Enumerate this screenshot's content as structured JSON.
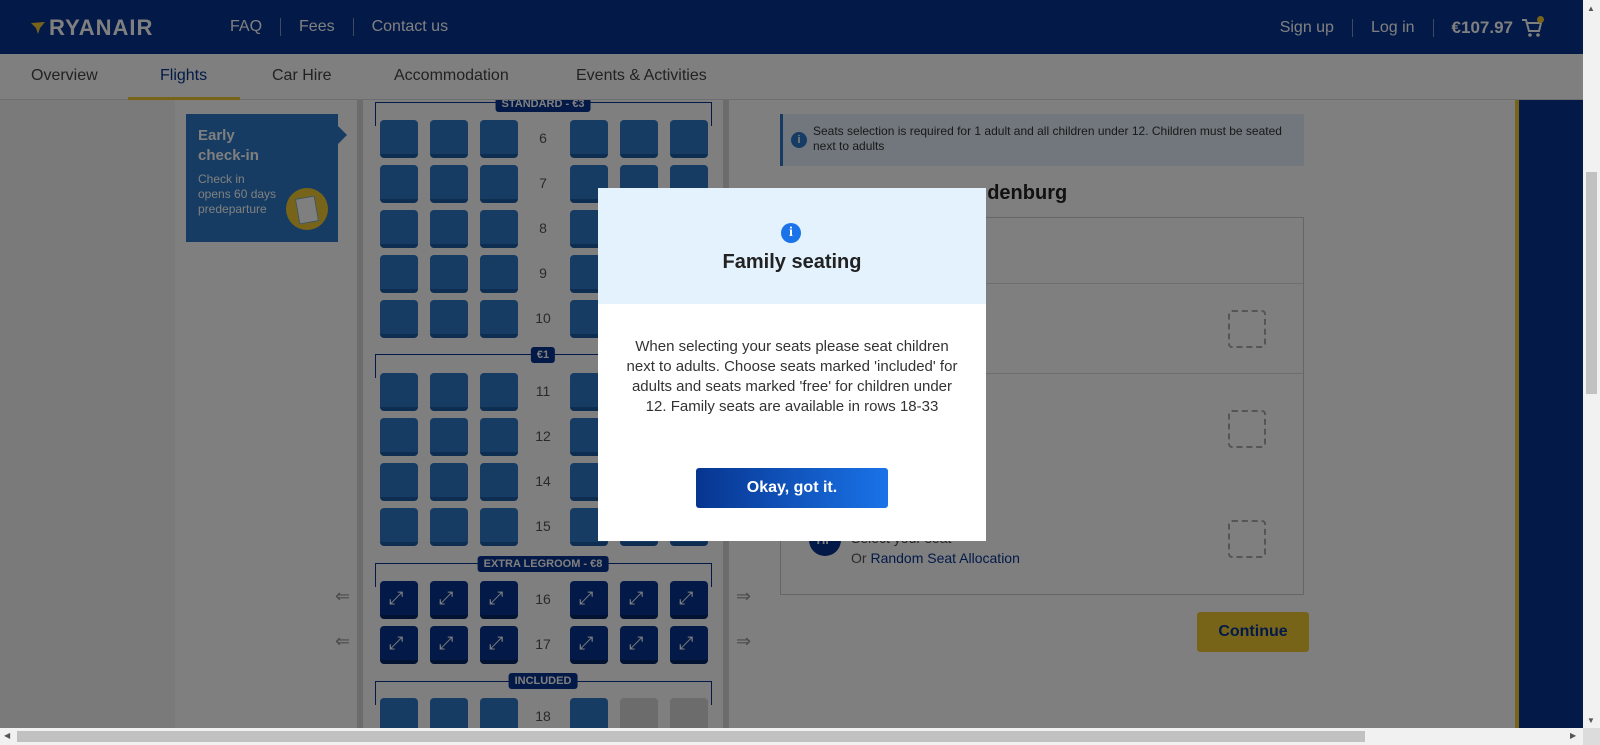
{
  "header": {
    "brand": "RYANAIR",
    "links": [
      "FAQ",
      "Fees",
      "Contact us"
    ],
    "sign_up": "Sign up",
    "log_in": "Log in",
    "basket_total": "€107.97"
  },
  "subnav": {
    "tabs": [
      "Overview",
      "Flights",
      "Car Hire",
      "Accommodation",
      "Events & Activities"
    ],
    "active": "Flights"
  },
  "promo": {
    "title_line1": "Early",
    "title_line2": "check-in",
    "text": "Check in opens 60 days predeparture"
  },
  "seatmap": {
    "section_standard": "STANDARD - €3",
    "section_euro1": "€1",
    "section_legroom": "EXTRA LEGROOM - €8",
    "section_included": "INCLUDED",
    "rows": [
      "6",
      "7",
      "8",
      "9",
      "10",
      "11",
      "12",
      "14",
      "15",
      "16",
      "17",
      "18"
    ]
  },
  "panel": {
    "info_text": "Seats selection is required for 1 adult and all children under 12. Children must be seated next to adults",
    "route_title": "ndenburg",
    "passenger_initials": "HP",
    "select_seat": "Select your seat",
    "or_text": "Or ",
    "random_seat": "Random Seat Allocation",
    "continue": "Continue"
  },
  "modal": {
    "icon": "i",
    "title": "Family seating",
    "body": "When selecting your seats please seat children next to adults. Choose seats marked 'included' for adults and seats marked 'free' for children under 12. Family seats are available in rows 18-33",
    "button": "Okay, got it."
  },
  "colors": {
    "brand_blue": "#073590",
    "accent_yellow": "#f1c933",
    "seat_blue": "#2c79c7"
  }
}
